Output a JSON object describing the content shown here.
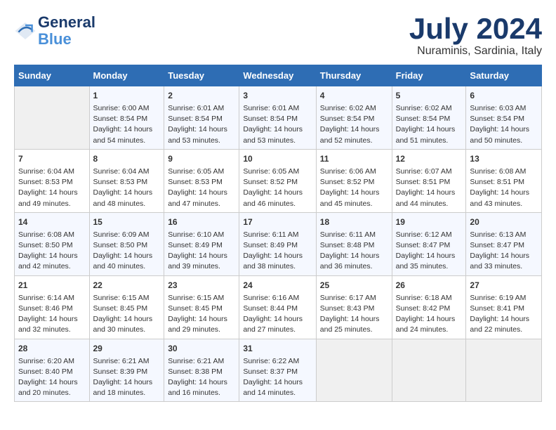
{
  "logo": {
    "line1": "General",
    "line2": "Blue"
  },
  "title": "July 2024",
  "subtitle": "Nuraminis, Sardinia, Italy",
  "days_of_week": [
    "Sunday",
    "Monday",
    "Tuesday",
    "Wednesday",
    "Thursday",
    "Friday",
    "Saturday"
  ],
  "weeks": [
    [
      {
        "day": "",
        "empty": true
      },
      {
        "day": "1",
        "sunrise": "Sunrise: 6:00 AM",
        "sunset": "Sunset: 8:54 PM",
        "daylight": "Daylight: 14 hours and 54 minutes."
      },
      {
        "day": "2",
        "sunrise": "Sunrise: 6:01 AM",
        "sunset": "Sunset: 8:54 PM",
        "daylight": "Daylight: 14 hours and 53 minutes."
      },
      {
        "day": "3",
        "sunrise": "Sunrise: 6:01 AM",
        "sunset": "Sunset: 8:54 PM",
        "daylight": "Daylight: 14 hours and 53 minutes."
      },
      {
        "day": "4",
        "sunrise": "Sunrise: 6:02 AM",
        "sunset": "Sunset: 8:54 PM",
        "daylight": "Daylight: 14 hours and 52 minutes."
      },
      {
        "day": "5",
        "sunrise": "Sunrise: 6:02 AM",
        "sunset": "Sunset: 8:54 PM",
        "daylight": "Daylight: 14 hours and 51 minutes."
      },
      {
        "day": "6",
        "sunrise": "Sunrise: 6:03 AM",
        "sunset": "Sunset: 8:54 PM",
        "daylight": "Daylight: 14 hours and 50 minutes."
      }
    ],
    [
      {
        "day": "7",
        "sunrise": "Sunrise: 6:04 AM",
        "sunset": "Sunset: 8:53 PM",
        "daylight": "Daylight: 14 hours and 49 minutes."
      },
      {
        "day": "8",
        "sunrise": "Sunrise: 6:04 AM",
        "sunset": "Sunset: 8:53 PM",
        "daylight": "Daylight: 14 hours and 48 minutes."
      },
      {
        "day": "9",
        "sunrise": "Sunrise: 6:05 AM",
        "sunset": "Sunset: 8:53 PM",
        "daylight": "Daylight: 14 hours and 47 minutes."
      },
      {
        "day": "10",
        "sunrise": "Sunrise: 6:05 AM",
        "sunset": "Sunset: 8:52 PM",
        "daylight": "Daylight: 14 hours and 46 minutes."
      },
      {
        "day": "11",
        "sunrise": "Sunrise: 6:06 AM",
        "sunset": "Sunset: 8:52 PM",
        "daylight": "Daylight: 14 hours and 45 minutes."
      },
      {
        "day": "12",
        "sunrise": "Sunrise: 6:07 AM",
        "sunset": "Sunset: 8:51 PM",
        "daylight": "Daylight: 14 hours and 44 minutes."
      },
      {
        "day": "13",
        "sunrise": "Sunrise: 6:08 AM",
        "sunset": "Sunset: 8:51 PM",
        "daylight": "Daylight: 14 hours and 43 minutes."
      }
    ],
    [
      {
        "day": "14",
        "sunrise": "Sunrise: 6:08 AM",
        "sunset": "Sunset: 8:50 PM",
        "daylight": "Daylight: 14 hours and 42 minutes."
      },
      {
        "day": "15",
        "sunrise": "Sunrise: 6:09 AM",
        "sunset": "Sunset: 8:50 PM",
        "daylight": "Daylight: 14 hours and 40 minutes."
      },
      {
        "day": "16",
        "sunrise": "Sunrise: 6:10 AM",
        "sunset": "Sunset: 8:49 PM",
        "daylight": "Daylight: 14 hours and 39 minutes."
      },
      {
        "day": "17",
        "sunrise": "Sunrise: 6:11 AM",
        "sunset": "Sunset: 8:49 PM",
        "daylight": "Daylight: 14 hours and 38 minutes."
      },
      {
        "day": "18",
        "sunrise": "Sunrise: 6:11 AM",
        "sunset": "Sunset: 8:48 PM",
        "daylight": "Daylight: 14 hours and 36 minutes."
      },
      {
        "day": "19",
        "sunrise": "Sunrise: 6:12 AM",
        "sunset": "Sunset: 8:47 PM",
        "daylight": "Daylight: 14 hours and 35 minutes."
      },
      {
        "day": "20",
        "sunrise": "Sunrise: 6:13 AM",
        "sunset": "Sunset: 8:47 PM",
        "daylight": "Daylight: 14 hours and 33 minutes."
      }
    ],
    [
      {
        "day": "21",
        "sunrise": "Sunrise: 6:14 AM",
        "sunset": "Sunset: 8:46 PM",
        "daylight": "Daylight: 14 hours and 32 minutes."
      },
      {
        "day": "22",
        "sunrise": "Sunrise: 6:15 AM",
        "sunset": "Sunset: 8:45 PM",
        "daylight": "Daylight: 14 hours and 30 minutes."
      },
      {
        "day": "23",
        "sunrise": "Sunrise: 6:15 AM",
        "sunset": "Sunset: 8:45 PM",
        "daylight": "Daylight: 14 hours and 29 minutes."
      },
      {
        "day": "24",
        "sunrise": "Sunrise: 6:16 AM",
        "sunset": "Sunset: 8:44 PM",
        "daylight": "Daylight: 14 hours and 27 minutes."
      },
      {
        "day": "25",
        "sunrise": "Sunrise: 6:17 AM",
        "sunset": "Sunset: 8:43 PM",
        "daylight": "Daylight: 14 hours and 25 minutes."
      },
      {
        "day": "26",
        "sunrise": "Sunrise: 6:18 AM",
        "sunset": "Sunset: 8:42 PM",
        "daylight": "Daylight: 14 hours and 24 minutes."
      },
      {
        "day": "27",
        "sunrise": "Sunrise: 6:19 AM",
        "sunset": "Sunset: 8:41 PM",
        "daylight": "Daylight: 14 hours and 22 minutes."
      }
    ],
    [
      {
        "day": "28",
        "sunrise": "Sunrise: 6:20 AM",
        "sunset": "Sunset: 8:40 PM",
        "daylight": "Daylight: 14 hours and 20 minutes."
      },
      {
        "day": "29",
        "sunrise": "Sunrise: 6:21 AM",
        "sunset": "Sunset: 8:39 PM",
        "daylight": "Daylight: 14 hours and 18 minutes."
      },
      {
        "day": "30",
        "sunrise": "Sunrise: 6:21 AM",
        "sunset": "Sunset: 8:38 PM",
        "daylight": "Daylight: 14 hours and 16 minutes."
      },
      {
        "day": "31",
        "sunrise": "Sunrise: 6:22 AM",
        "sunset": "Sunset: 8:37 PM",
        "daylight": "Daylight: 14 hours and 14 minutes."
      },
      {
        "day": "",
        "empty": true
      },
      {
        "day": "",
        "empty": true
      },
      {
        "day": "",
        "empty": true
      }
    ]
  ]
}
